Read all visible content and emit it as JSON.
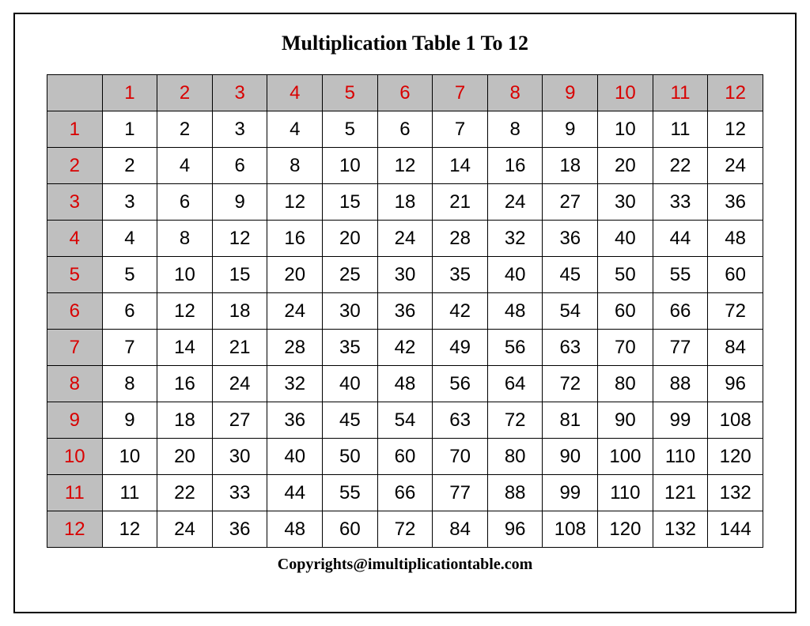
{
  "title": "Multiplication Table 1 To 12",
  "headers": [
    "1",
    "2",
    "3",
    "4",
    "5",
    "6",
    "7",
    "8",
    "9",
    "10",
    "11",
    "12"
  ],
  "rows": [
    {
      "label": "1",
      "cells": [
        "1",
        "2",
        "3",
        "4",
        "5",
        "6",
        "7",
        "8",
        "9",
        "10",
        "11",
        "12"
      ]
    },
    {
      "label": "2",
      "cells": [
        "2",
        "4",
        "6",
        "8",
        "10",
        "12",
        "14",
        "16",
        "18",
        "20",
        "22",
        "24"
      ]
    },
    {
      "label": "3",
      "cells": [
        "3",
        "6",
        "9",
        "12",
        "15",
        "18",
        "21",
        "24",
        "27",
        "30",
        "33",
        "36"
      ]
    },
    {
      "label": "4",
      "cells": [
        "4",
        "8",
        "12",
        "16",
        "20",
        "24",
        "28",
        "32",
        "36",
        "40",
        "44",
        "48"
      ]
    },
    {
      "label": "5",
      "cells": [
        "5",
        "10",
        "15",
        "20",
        "25",
        "30",
        "35",
        "40",
        "45",
        "50",
        "55",
        "60"
      ]
    },
    {
      "label": "6",
      "cells": [
        "6",
        "12",
        "18",
        "24",
        "30",
        "36",
        "42",
        "48",
        "54",
        "60",
        "66",
        "72"
      ]
    },
    {
      "label": "7",
      "cells": [
        "7",
        "14",
        "21",
        "28",
        "35",
        "42",
        "49",
        "56",
        "63",
        "70",
        "77",
        "84"
      ]
    },
    {
      "label": "8",
      "cells": [
        "8",
        "16",
        "24",
        "32",
        "40",
        "48",
        "56",
        "64",
        "72",
        "80",
        "88",
        "96"
      ]
    },
    {
      "label": "9",
      "cells": [
        "9",
        "18",
        "27",
        "36",
        "45",
        "54",
        "63",
        "72",
        "81",
        "90",
        "99",
        "108"
      ]
    },
    {
      "label": "10",
      "cells": [
        "10",
        "20",
        "30",
        "40",
        "50",
        "60",
        "70",
        "80",
        "90",
        "100",
        "110",
        "120"
      ]
    },
    {
      "label": "11",
      "cells": [
        "11",
        "22",
        "33",
        "44",
        "55",
        "66",
        "77",
        "88",
        "99",
        "110",
        "121",
        "132"
      ]
    },
    {
      "label": "12",
      "cells": [
        "12",
        "24",
        "36",
        "48",
        "60",
        "72",
        "84",
        "96",
        "108",
        "120",
        "132",
        "144"
      ]
    }
  ],
  "copyright": "Copyrights@imultiplicationtable.com"
}
